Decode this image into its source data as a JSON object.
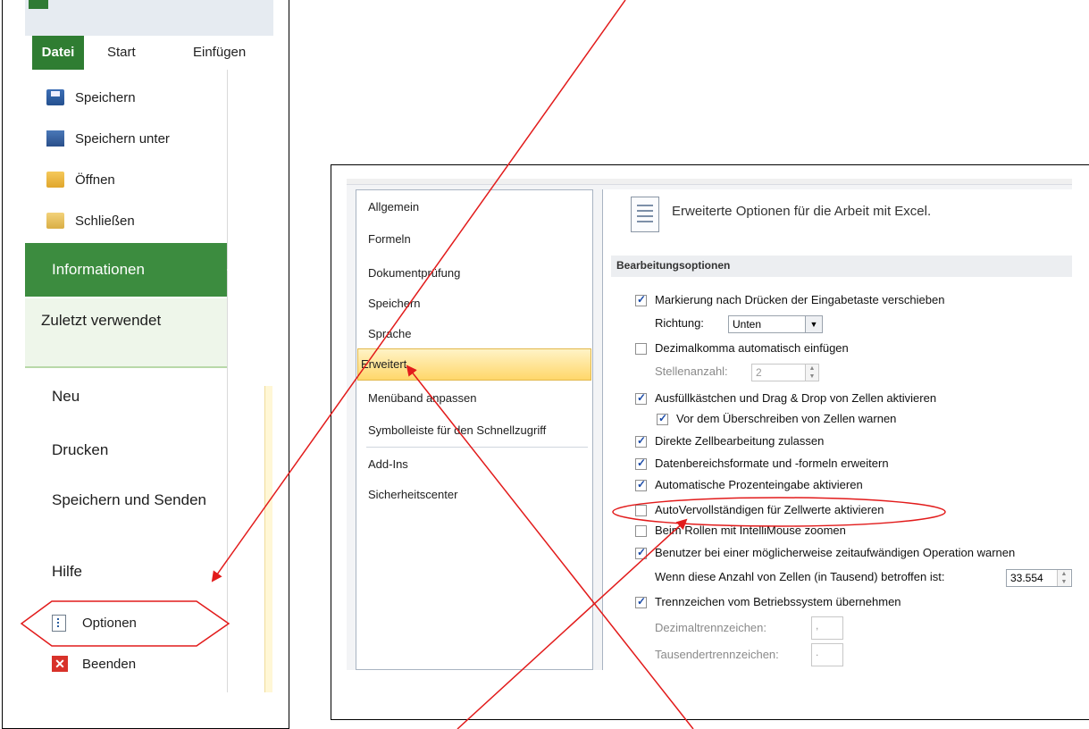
{
  "ribbon": {
    "tabs": [
      "Datei",
      "Start",
      "Einfügen"
    ]
  },
  "backstage": {
    "commands": [
      {
        "label": "Speichern",
        "icon": "save-icon"
      },
      {
        "label": "Speichern unter",
        "icon": "save-as-icon"
      },
      {
        "label": "Öffnen",
        "icon": "open-folder-icon"
      },
      {
        "label": "Schließen",
        "icon": "close-folder-icon"
      }
    ],
    "nav": {
      "informationen": "Informationen",
      "zuletzt": "Zuletzt verwendet",
      "neu": "Neu",
      "drucken": "Drucken",
      "speichern_senden": "Speichern und Senden",
      "hilfe": "Hilfe"
    },
    "optionen": "Optionen",
    "beenden": "Beenden",
    "accent_color": "#3c8c3f"
  },
  "dialog": {
    "categories": [
      "Allgemein",
      "Formeln",
      "Dokumentprüfung",
      "Speichern",
      "Sprache",
      "Erweitert",
      "Menüband anpassen",
      "Symbolleiste für den Schnellzugriff",
      "Add-Ins",
      "Sicherheitscenter"
    ],
    "selected_category": "Erweitert",
    "title": "Erweiterte Optionen für die Arbeit mit Excel.",
    "section": "Bearbeitungsoptionen",
    "options": {
      "move_selection": {
        "label": "Markierung nach Drücken der Eingabetaste verschieben",
        "checked": true
      },
      "direction_label": "Richtung:",
      "direction_value": "Unten",
      "auto_decimal": {
        "label": "Dezimalkomma automatisch einfügen",
        "checked": false
      },
      "places_label": "Stellenanzahl:",
      "places_value": "2",
      "fill_handle": {
        "label": "Ausfüllkästchen und Drag & Drop von Zellen aktivieren",
        "checked": true
      },
      "overwrite_warn": {
        "label": "Vor dem Überschreiben von Zellen warnen",
        "checked": true
      },
      "direct_edit": {
        "label": "Direkte Zellbearbeitung zulassen",
        "checked": true
      },
      "extend_formats": {
        "label": "Datenbereichsformate und -formeln erweitern",
        "checked": true
      },
      "auto_percent": {
        "label": "Automatische Prozenteingabe aktivieren",
        "checked": true
      },
      "autocomplete": {
        "label": "AutoVervollständigen für Zellwerte aktivieren",
        "checked": false
      },
      "intellimouse": {
        "label": "Beim Rollen mit IntelliMouse zoomen",
        "checked": false
      },
      "alert_slow": {
        "label": "Benutzer bei einer möglicherweise zeitaufwändigen Operation warnen",
        "checked": true
      },
      "cells_label": "Wenn diese Anzahl von Zellen (in Tausend) betroffen ist:",
      "cells_value": "33.554",
      "system_sep": {
        "label": "Trennzeichen vom Betriebssystem übernehmen",
        "checked": true
      },
      "decimal_sep_label": "Dezimaltrennzeichen:",
      "decimal_sep_value": ",",
      "thousands_sep_label": "Tausendertrennzeichen:",
      "thousands_sep_value": "."
    }
  },
  "annotation_color": "#e21b1b"
}
